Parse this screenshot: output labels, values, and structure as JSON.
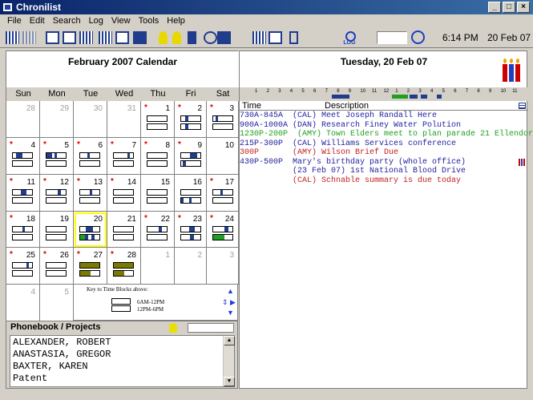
{
  "window": {
    "title": "Chronilist"
  },
  "menu": [
    "File",
    "Edit",
    "Search",
    "Log",
    "View",
    "Tools",
    "Help"
  ],
  "toolbar": {
    "log_label": "LOG",
    "clock_time": "6:14 PM",
    "clock_date": "20 Feb 07"
  },
  "calendar": {
    "title": "February 2007 Calendar",
    "days_of_week": [
      "Sun",
      "Mon",
      "Tue",
      "Wed",
      "Thu",
      "Fri",
      "Sat"
    ],
    "weeks": [
      [
        {
          "d": "28",
          "g": true
        },
        {
          "d": "29",
          "g": true
        },
        {
          "d": "30",
          "g": true
        },
        {
          "d": "31",
          "g": true
        },
        {
          "d": "1",
          "s": true
        },
        {
          "d": "2",
          "s": true
        },
        {
          "d": "3",
          "s": true
        }
      ],
      [
        {
          "d": "4",
          "s": true
        },
        {
          "d": "5",
          "s": true
        },
        {
          "d": "6",
          "s": true
        },
        {
          "d": "7",
          "s": true
        },
        {
          "d": "8",
          "s": true
        },
        {
          "d": "9",
          "s": true
        },
        {
          "d": "10"
        }
      ],
      [
        {
          "d": "11",
          "s": true
        },
        {
          "d": "12",
          "s": true
        },
        {
          "d": "13",
          "s": true
        },
        {
          "d": "14",
          "s": true
        },
        {
          "d": "15"
        },
        {
          "d": "16"
        },
        {
          "d": "17",
          "s": true
        }
      ],
      [
        {
          "d": "18",
          "s": true
        },
        {
          "d": "19"
        },
        {
          "d": "20",
          "today": true
        },
        {
          "d": "21"
        },
        {
          "d": "22",
          "s": true
        },
        {
          "d": "23",
          "s": true
        },
        {
          "d": "24",
          "s": true
        }
      ],
      [
        {
          "d": "25",
          "s": true
        },
        {
          "d": "26",
          "s": true
        },
        {
          "d": "27",
          "s": true
        },
        {
          "d": "28",
          "s": true
        },
        {
          "d": "1",
          "g": true
        },
        {
          "d": "2",
          "g": true
        },
        {
          "d": "3",
          "g": true
        }
      ],
      [
        {
          "d": "4",
          "g": true
        },
        {
          "d": "5",
          "g": true
        }
      ]
    ],
    "key_title": "Key to Time Blocks above:",
    "key_am": "6AM-12PM",
    "key_pm": "12PM-6PM"
  },
  "phonebook": {
    "title": "Phonebook / Projects",
    "entries": [
      "ALEXANDER, ROBERT",
      "ANASTASIA, GREGOR",
      "BAXTER, KAREN",
      "Patent"
    ]
  },
  "day": {
    "title": "Tuesday, 20 Feb 07",
    "hours": [
      "1",
      "2",
      "3",
      "4",
      "5",
      "6",
      "7",
      "8",
      "9",
      "10",
      "11",
      "12",
      "1",
      "2",
      "3",
      "4",
      "5",
      "6",
      "7",
      "8",
      "9",
      "10",
      "11"
    ],
    "col_time": "Time",
    "col_description": "Description",
    "events": [
      {
        "text": "730A-845A  (CAL) Meet Joseph Randall Here",
        "color": "#1f1f9f"
      },
      {
        "text": "900A-1000A (DAN) Research Finey Water Polution",
        "color": "#1f1f9f"
      },
      {
        "text": "1230P-200P  (AMY) Town Elders meet to plan parade 21 Ellendor",
        "color": "#1f9f1f"
      },
      {
        "text": "215P-300P  (CAL) Williams Services conference",
        "color": "#1f1f9f"
      },
      {
        "text": "300P       (AMY) Wilson Brief Due",
        "color": "#c01f1f"
      },
      {
        "text": "430P-500P  Mary's birthday party (whole office)",
        "color": "#1f1f9f",
        "icon": true
      },
      {
        "text": "           (23 Feb 07) 1st National Blood Drive",
        "color": "#1f1f9f"
      },
      {
        "text": "           (CAL) Schnable summary is due today",
        "color": "#c01f1f"
      }
    ]
  }
}
